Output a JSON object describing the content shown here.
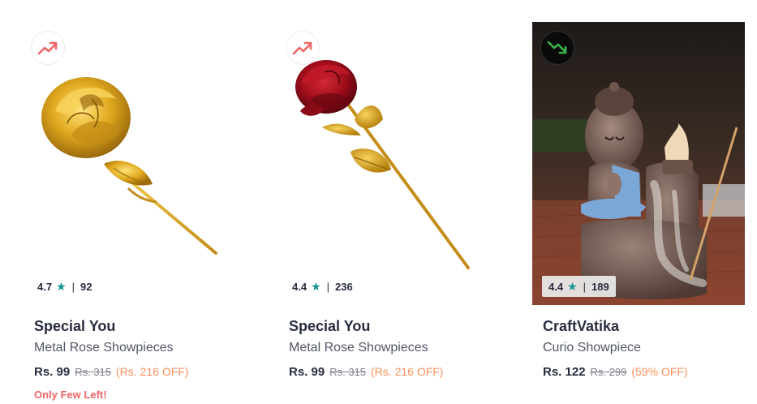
{
  "colors": {
    "text_primary": "#282c3f",
    "text_secondary": "#535766",
    "rating_star": "#14958f",
    "discount": "#ff905a",
    "low_stock": "#f16565",
    "trend_up": "#f16565",
    "trend_down": "#3bb54a"
  },
  "products": [
    {
      "trend_icon": "trending-up-icon",
      "rating": "4.7",
      "rating_separator": "|",
      "rating_count": "92",
      "brand": "Special You",
      "name": "Metal Rose Showpieces",
      "price": "Rs. 99",
      "mrp": "Rs. 315",
      "discount": "(Rs. 216 OFF)",
      "stock_note": "Only Few Left!"
    },
    {
      "trend_icon": "trending-up-icon",
      "rating": "4.4",
      "rating_separator": "|",
      "rating_count": "236",
      "brand": "Special You",
      "name": "Metal Rose Showpieces",
      "price": "Rs. 99",
      "mrp": "Rs. 315",
      "discount": "(Rs. 216 OFF)"
    },
    {
      "trend_icon": "trending-down-icon",
      "rating": "4.4",
      "rating_separator": "|",
      "rating_count": "189",
      "brand": "CraftVatika",
      "name": "Curio Showpiece",
      "price": "Rs. 122",
      "mrp": "Rs. 299",
      "discount": "(59% OFF)"
    }
  ]
}
